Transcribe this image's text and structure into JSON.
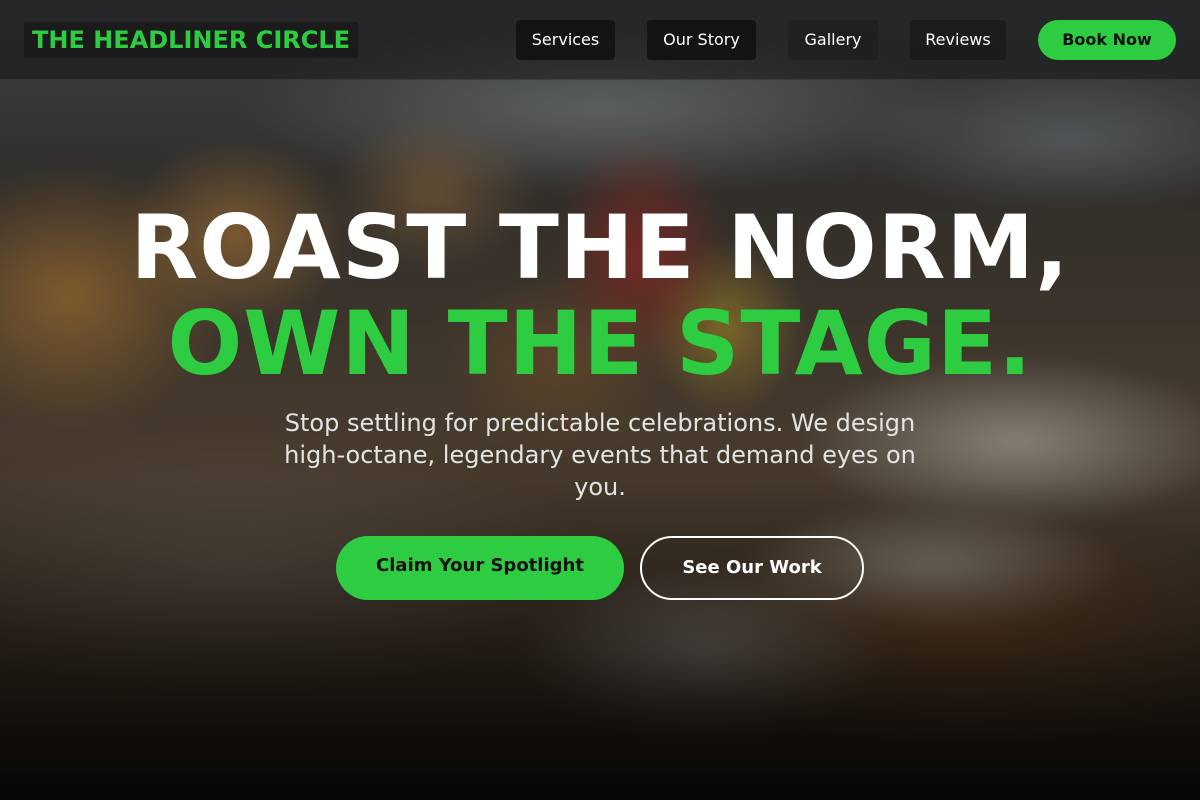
{
  "header": {
    "logo": "THE HEADLINER CIRCLE",
    "nav": [
      {
        "label": "Services"
      },
      {
        "label": "Our Story"
      },
      {
        "label": "Gallery"
      },
      {
        "label": "Reviews"
      }
    ],
    "cta": "Book Now"
  },
  "hero": {
    "headline_line1": "ROAST THE NORM,",
    "headline_line2": "OWN THE STAGE.",
    "subtitle": "Stop settling for predictable celebrations. We design high-octane, legendary events that demand eyes on you.",
    "primary_button": "Claim Your Spotlight",
    "secondary_button": "See Our Work"
  },
  "colors": {
    "accent": "#2ecc40",
    "header_bg": "#141414",
    "text_light": "#ffffff"
  }
}
